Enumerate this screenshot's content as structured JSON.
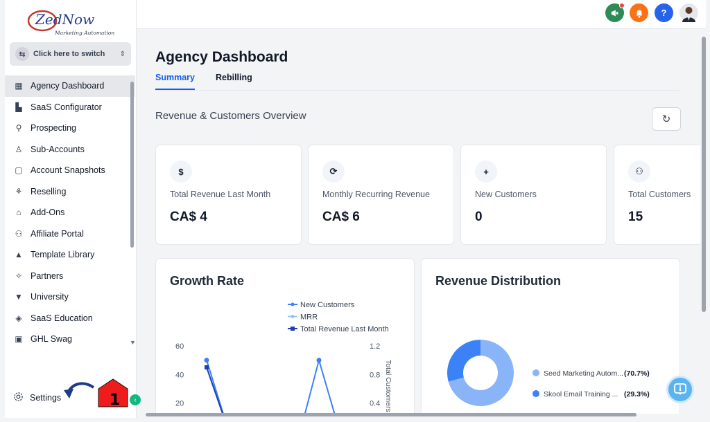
{
  "brand": {
    "name": "ZedNow",
    "tagline": "Marketing Automation"
  },
  "switcher": {
    "label": "Click here to switch"
  },
  "sidebar": {
    "items": [
      {
        "label": "Agency Dashboard",
        "icon": "dashboard-icon",
        "active": true
      },
      {
        "label": "SaaS Configurator",
        "icon": "chart-icon"
      },
      {
        "label": "Prospecting",
        "icon": "prospect-icon"
      },
      {
        "label": "Sub-Accounts",
        "icon": "user-icon"
      },
      {
        "label": "Account Snapshots",
        "icon": "snapshot-icon"
      },
      {
        "label": "Reselling",
        "icon": "reselling-icon"
      },
      {
        "label": "Add-Ons",
        "icon": "bag-icon"
      },
      {
        "label": "Affiliate Portal",
        "icon": "users-icon"
      },
      {
        "label": "Template Library",
        "icon": "template-icon"
      },
      {
        "label": "Partners",
        "icon": "handshake-icon"
      },
      {
        "label": "University",
        "icon": "graduation-icon"
      },
      {
        "label": "SaaS Education",
        "icon": "box-icon"
      },
      {
        "label": "GHL Swag",
        "icon": "shirt-icon"
      }
    ],
    "settings_label": "Settings",
    "annotation_number": "1"
  },
  "topbar": {
    "buttons": [
      {
        "icon": "megaphone-icon",
        "color": "#2e8b57"
      },
      {
        "icon": "bell-icon",
        "color": "#f97316"
      },
      {
        "icon": "help-icon",
        "label": "?",
        "color": "#2563eb"
      }
    ]
  },
  "main": {
    "title": "Agency Dashboard",
    "tabs": [
      {
        "label": "Summary",
        "active": true
      },
      {
        "label": "Rebilling"
      }
    ],
    "section_title": "Revenue & Customers Overview",
    "cards": [
      {
        "icon": "dollar-icon",
        "glyph": "$",
        "label": "Total Revenue Last Month",
        "value": "CA$ 4"
      },
      {
        "icon": "recurring-icon",
        "glyph": "⟳",
        "label": "Monthly Recurring Revenue",
        "value": "CA$ 6"
      },
      {
        "icon": "user-plus-icon",
        "glyph": "+",
        "label": "New Customers",
        "value": "0"
      },
      {
        "icon": "users-icon",
        "glyph": "⚇",
        "label": "Total Customers",
        "value": "15"
      }
    ],
    "growth_panel_title": "Growth Rate",
    "distribution_panel_title": "Revenue Distribution"
  },
  "chart_data": [
    {
      "type": "line",
      "title": "Growth Rate",
      "series": [
        {
          "name": "New Customers",
          "color": "#3b82f6",
          "values": [
            50,
            0,
            0,
            50,
            0
          ]
        },
        {
          "name": "MRR",
          "color": "#93c5fd",
          "values": []
        },
        {
          "name": "Total Revenue Last Month",
          "color": "#1e40af",
          "values": [
            45,
            0
          ]
        }
      ],
      "ylabel_right": "Total Customers",
      "yticks_left": [
        "60",
        "40",
        "20"
      ],
      "yticks_right": [
        "1.2",
        "0.8",
        "0.4"
      ],
      "ylim_left": [
        0,
        60
      ],
      "ylim_right": [
        0,
        1.2
      ],
      "legend": "top"
    },
    {
      "type": "pie",
      "title": "Revenue Distribution",
      "slices": [
        {
          "label": "Seed Marketing Autom...",
          "value": 70.7,
          "pct": "(70.7%)",
          "color": "#8ab4f8"
        },
        {
          "label": "Skool Email Training ...",
          "value": 29.3,
          "pct": "(29.3%)",
          "color": "#3b82f6"
        }
      ],
      "donut": true,
      "legend": "right"
    }
  ]
}
